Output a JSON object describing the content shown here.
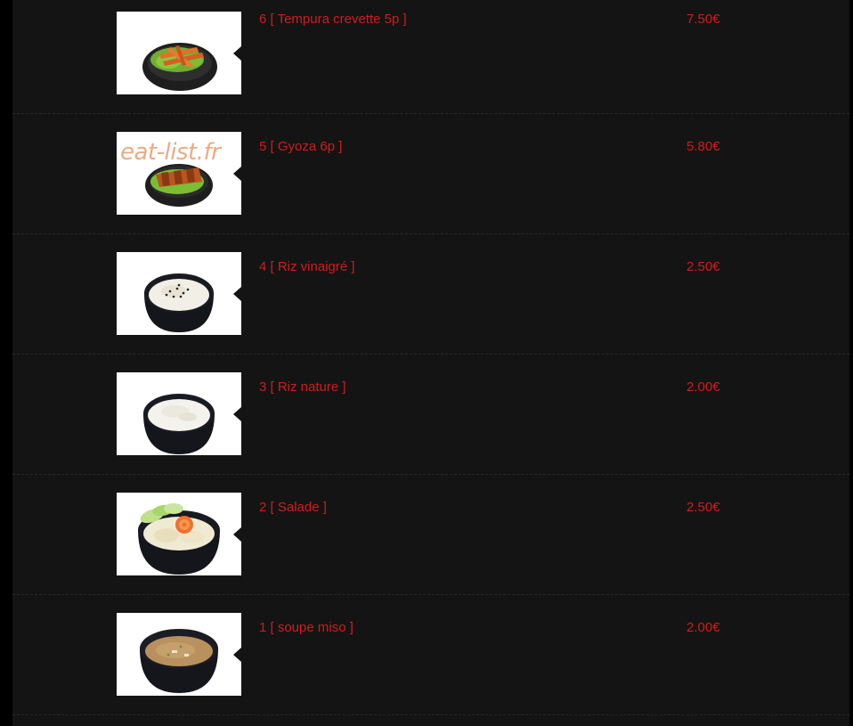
{
  "menu": {
    "items": [
      {
        "name": "6 [ Tempura crevette 5p ]",
        "price": "7.50€",
        "image": "tempura-shrimp-plate"
      },
      {
        "name": "5 [ Gyoza 6p ]",
        "price": "5.80€",
        "image": "gyoza-plate",
        "watermark": "eat-list.fr"
      },
      {
        "name": "4 [ Riz vinaigré ]",
        "price": "2.50€",
        "image": "vinegared-rice-bowl"
      },
      {
        "name": "3 [ Riz nature ]",
        "price": "2.00€",
        "image": "plain-rice-bowl"
      },
      {
        "name": "2 [ Salade ]",
        "price": "2.50€",
        "image": "salad-bowl"
      },
      {
        "name": "1 [ soupe miso ]",
        "price": "2.00€",
        "image": "miso-soup-bowl"
      }
    ]
  },
  "colors": {
    "background": "#141414",
    "text_accent": "#d21c1c",
    "divider": "#2a2a2a"
  }
}
